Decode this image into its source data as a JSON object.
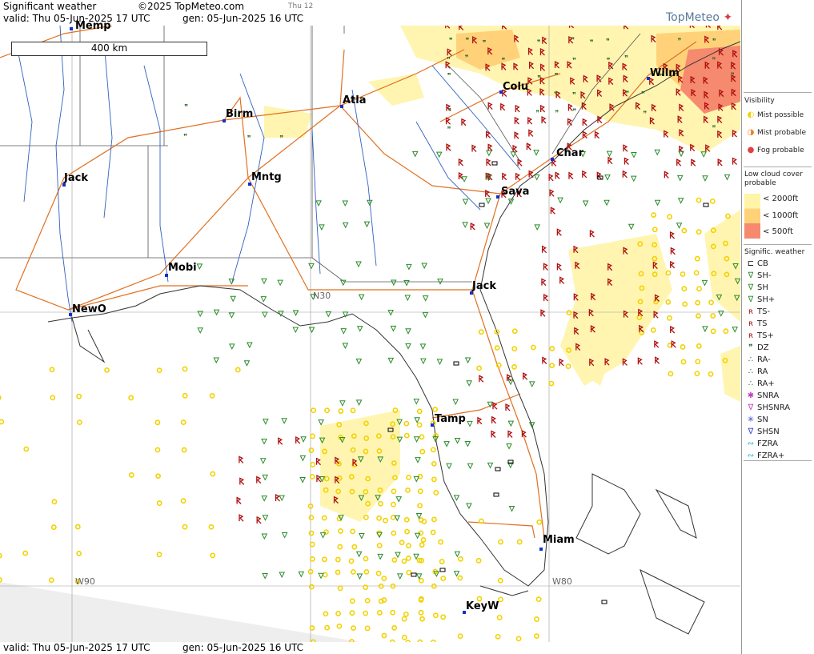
{
  "header": {
    "title": "Significant weather",
    "copyright": "©2025 TopMeteo.com",
    "tab_hint": "Thu 12",
    "valid": "valid:  Thu  05-Jun-2025  17 UTC",
    "gen": "gen: 05-Jun-2025 16 UTC",
    "logo": "TopMeteo"
  },
  "map": {
    "scale_label": "400 km",
    "grid_labels": [
      "N30",
      "W90",
      "W80"
    ],
    "cities": [
      {
        "name": "Memp"
      },
      {
        "name": "Birm"
      },
      {
        "name": "Atla"
      },
      {
        "name": "Colu"
      },
      {
        "name": "Wilm"
      },
      {
        "name": "Char"
      },
      {
        "name": "Jack"
      },
      {
        "name": "Mntg"
      },
      {
        "name": "Sava"
      },
      {
        "name": "Mobi"
      },
      {
        "name": "Jack"
      },
      {
        "name": "NewO"
      },
      {
        "name": "Tamp"
      },
      {
        "name": "Miam"
      },
      {
        "name": "KeyW"
      }
    ]
  },
  "legend": {
    "visibility_title": "Visibility",
    "visibility": [
      "Mist possible",
      "Mist probable",
      "Fog probable"
    ],
    "cloud_title": "Low cloud cover probable",
    "cloud": [
      "< 2000ft",
      "< 1000ft",
      "<   500ft"
    ],
    "sigwx_title": "Signific. weather",
    "sigwx": [
      "CB",
      "SH-",
      "SH",
      "SH+",
      "TS-",
      "TS",
      "TS+",
      "DZ",
      "RA-",
      "RA",
      "RA+",
      "SNRA",
      "SHSNRA",
      "SN",
      "SHSN",
      "FZRA",
      "FZRA+"
    ],
    "colors": {
      "thunder": "#b01010",
      "shower": "#2a8a2a",
      "mist": "#f2d200",
      "fog": "#e04040",
      "road": "#e07020",
      "river": "#3060c0"
    }
  }
}
